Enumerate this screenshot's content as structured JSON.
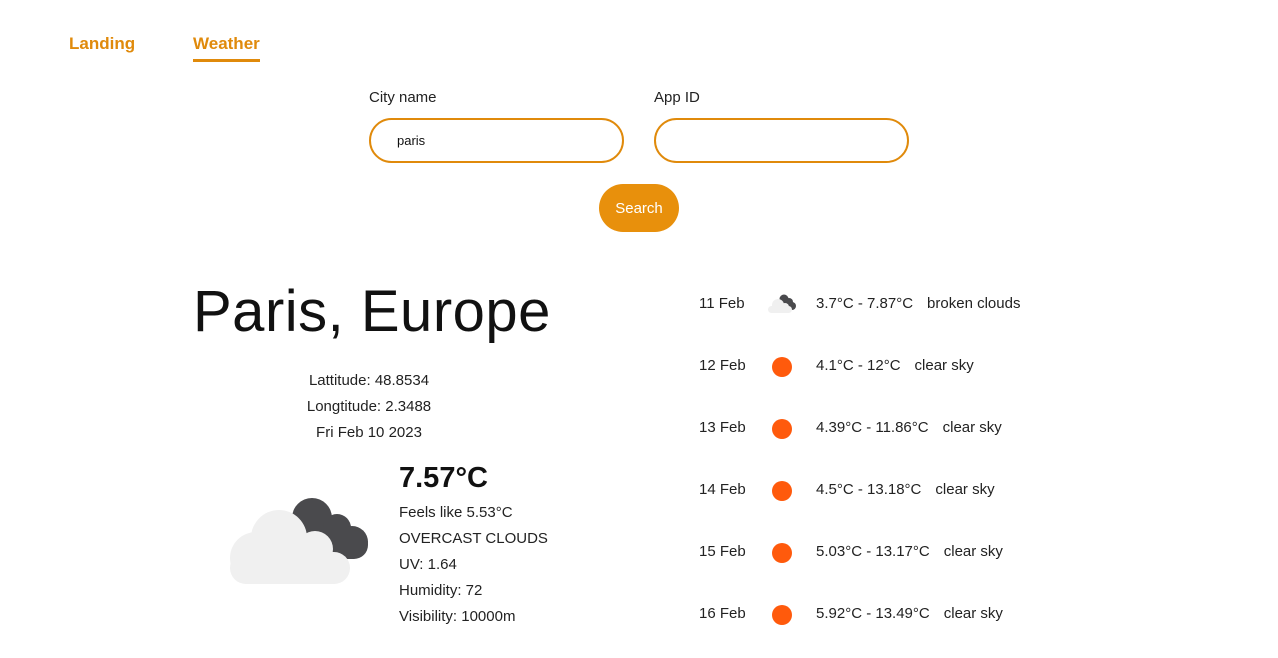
{
  "colors": {
    "accent": "#e08a0b",
    "button": "#e8900c",
    "sun": "#ff5a0c",
    "cloud_light": "#f0f0f0",
    "cloud_dark": "#4a4a4d"
  },
  "nav": {
    "items": [
      {
        "label": "Landing",
        "active": false
      },
      {
        "label": "Weather",
        "active": true
      }
    ]
  },
  "search": {
    "city_label": "City name",
    "city_value": "paris",
    "appid_label": "App ID",
    "appid_value": "",
    "button_label": "Search"
  },
  "location": {
    "title": "Paris, Europe",
    "latitude": "Lattitude: 48.8534",
    "longitude": "Longtitude: 2.3488",
    "date": "Fri Feb 10 2023"
  },
  "current": {
    "icon": "overcast-clouds-icon",
    "temp": "7.57°C",
    "feels_like": "Feels like 5.53°C",
    "description": "OVERCAST CLOUDS",
    "uv": "UV: 1.64",
    "humidity": "Humidity: 72",
    "visibility": "Visibility: 10000m"
  },
  "forecast": [
    {
      "date": "11 Feb",
      "icon": "broken-clouds-icon",
      "temp": "3.7°C - 7.87°C",
      "desc": "broken clouds"
    },
    {
      "date": "12 Feb",
      "icon": "sun-icon",
      "temp": "4.1°C - 12°C",
      "desc": "clear sky"
    },
    {
      "date": "13 Feb",
      "icon": "sun-icon",
      "temp": "4.39°C - 11.86°C",
      "desc": "clear sky"
    },
    {
      "date": "14 Feb",
      "icon": "sun-icon",
      "temp": "4.5°C - 13.18°C",
      "desc": "clear sky"
    },
    {
      "date": "15 Feb",
      "icon": "sun-icon",
      "temp": "5.03°C - 13.17°C",
      "desc": "clear sky"
    },
    {
      "date": "16 Feb",
      "icon": "sun-icon",
      "temp": "5.92°C - 13.49°C",
      "desc": "clear sky"
    }
  ]
}
